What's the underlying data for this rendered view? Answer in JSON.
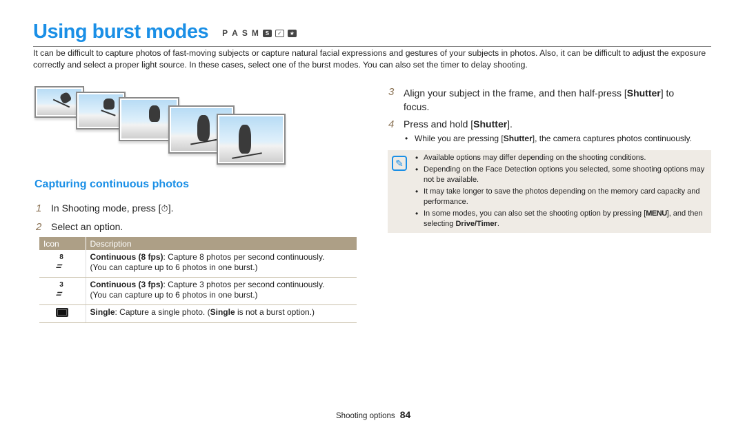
{
  "header": {
    "title": "Using burst modes",
    "mode_letters": [
      "P",
      "A",
      "S",
      "M"
    ],
    "mode_icons": [
      "smart-mode-icon",
      "scene-mode-icon",
      "smart-auto-mode-icon"
    ]
  },
  "intro": "It can be difficult to capture photos of fast-moving subjects or capture natural facial expressions and gestures of your subjects in photos. Also, it can be difficult to adjust the exposure correctly and select a proper light source. In these cases, select one of the burst modes. You can also set the timer to delay shooting.",
  "section": {
    "heading": "Capturing continuous photos",
    "steps": [
      {
        "num": "1",
        "text_before": "In Shooting mode, press [",
        "icon": "timer-drive-icon",
        "text_after": "]."
      },
      {
        "num": "2",
        "text": "Select an option."
      }
    ]
  },
  "table": {
    "headers": [
      "Icon",
      "Description"
    ],
    "rows": [
      {
        "icon": "continuous-8fps-icon",
        "icon_num": "8",
        "label": "Continuous (8 fps)",
        "desc": ": Capture 8 photos per second continuously.",
        "desc2": "(You can capture up to 6 photos in one burst.)"
      },
      {
        "icon": "continuous-3fps-icon",
        "icon_num": "3",
        "label": "Continuous (3 fps)",
        "desc": ": Capture 3 photos per second continuously.",
        "desc2": "(You can capture up to 6 photos in one burst.)"
      },
      {
        "icon": "single-icon",
        "label": "Single",
        "desc": ": Capture a single photo. (",
        "bold2": "Single",
        "desc_end": " is not a burst option.)"
      }
    ]
  },
  "right_steps": [
    {
      "num": "3",
      "line1_before": "Align your subject in the frame, and then half-press [",
      "bold": "Shutter",
      "line1_after": "] to",
      "line2": "focus."
    },
    {
      "num": "4",
      "before": "Press and hold [",
      "bold": "Shutter",
      "after": "]."
    }
  ],
  "step4_bullet": {
    "before": "While you are pressing [",
    "bold": "Shutter",
    "after": "], the camera captures photos continuously."
  },
  "notes": [
    {
      "text": "Available options may differ depending on the shooting conditions."
    },
    {
      "text": "Depending on the Face Detection options you selected, some shooting options may not be available."
    },
    {
      "text": "It may take longer to save the photos depending on the memory card capacity and performance."
    },
    {
      "before": "In some modes, you can also set the shooting option by pressing [",
      "menu": "MENU",
      "middle": "], and then selecting ",
      "bold": "Drive/Timer",
      "after": "."
    }
  ],
  "footer": {
    "section": "Shooting options",
    "page": "84"
  }
}
